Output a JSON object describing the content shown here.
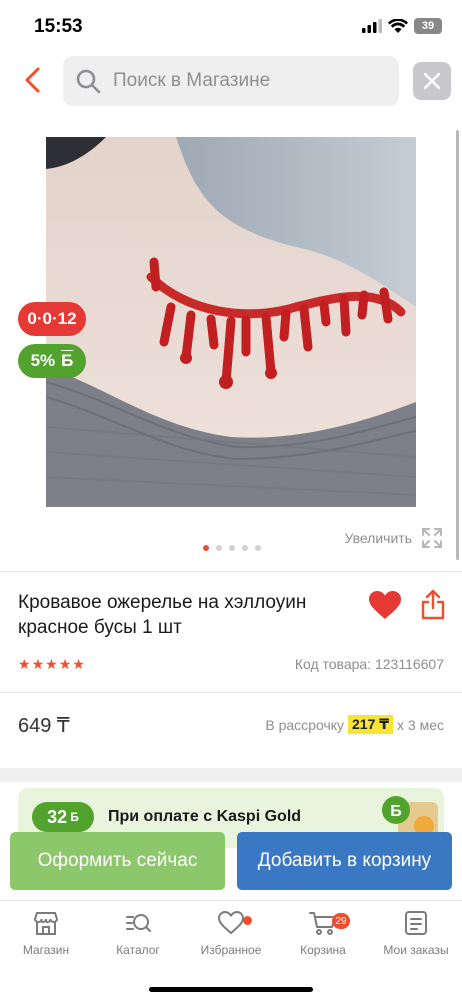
{
  "status_bar": {
    "time": "15:53",
    "battery": "39"
  },
  "search": {
    "placeholder": "Поиск в Магазине"
  },
  "badges": {
    "installment": "0·0·12",
    "bonus_percent": "5%",
    "bonus_currency": "Б"
  },
  "gallery": {
    "zoom_label": "Увеличить",
    "dot_count": 5,
    "active_index": 0
  },
  "product": {
    "title": "Кровавое ожерелье на хэллоуин красное бусы 1 шт",
    "rating_stars": 5,
    "sku_label": "Код товара: 123116607",
    "price": "649 ₸",
    "installment_prefix": "В рассрочку",
    "installment_amount": "217 ₸",
    "installment_suffix": "х 3 мес"
  },
  "kaspi_promo": {
    "bonus": "32",
    "currency": "Б",
    "text": "При оплате с Kaspi Gold"
  },
  "actions": {
    "buy_now": "Оформить сейчас",
    "add_to_cart": "Добавить в корзину"
  },
  "tabs": [
    {
      "label": "Магазин",
      "icon": "store-icon"
    },
    {
      "label": "Каталог",
      "icon": "catalog-icon"
    },
    {
      "label": "Избранное",
      "icon": "heart-icon",
      "dot": true
    },
    {
      "label": "Корзина",
      "icon": "cart-icon",
      "badge": "29"
    },
    {
      "label": "Мои заказы",
      "icon": "orders-icon"
    }
  ],
  "colors": {
    "accent": "#f24d2e",
    "kaspi_green": "#52a22e",
    "cart_blue": "#3a78c3",
    "buy_green": "#8dc76b"
  }
}
